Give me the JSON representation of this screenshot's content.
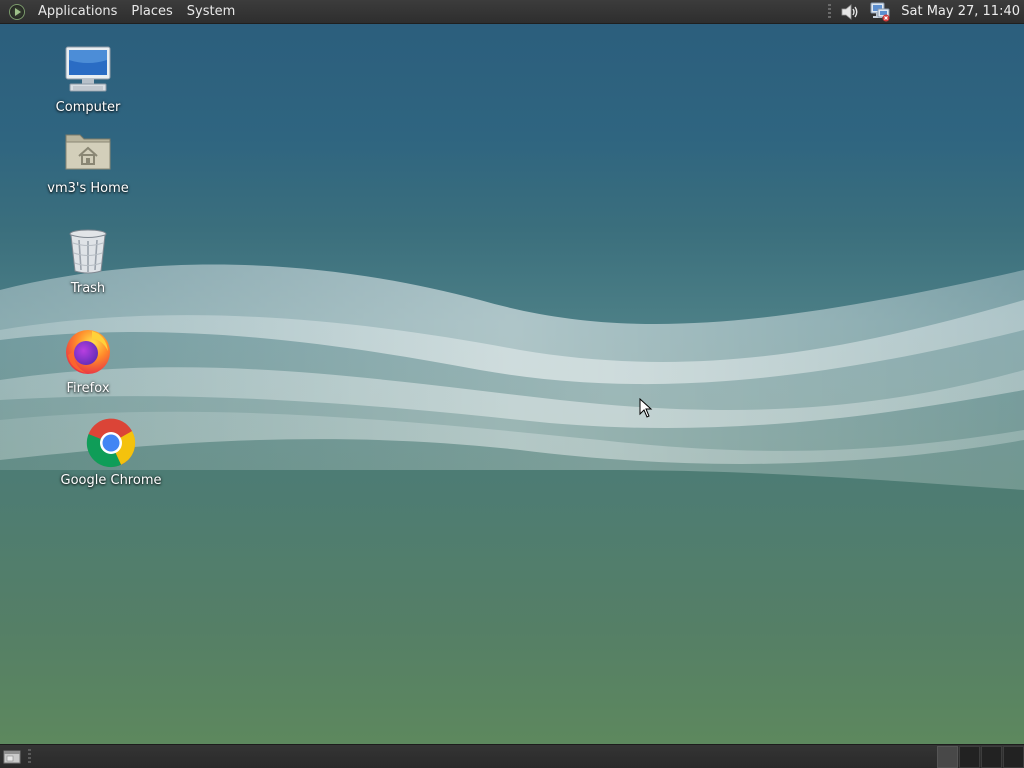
{
  "top_panel": {
    "menus": {
      "applications": "Applications",
      "places": "Places",
      "system": "System"
    },
    "clock": "Sat May 27, 11:40",
    "tray_icons": [
      "volume-icon",
      "network-icon"
    ]
  },
  "desktop": {
    "icons": [
      {
        "label": "Computer",
        "icon": "computer-icon"
      },
      {
        "label": "vm3's Home",
        "icon": "home-folder-icon"
      },
      {
        "label": "Trash",
        "icon": "trash-icon"
      },
      {
        "label": "Firefox",
        "icon": "firefox-icon"
      },
      {
        "label": "Google Chrome",
        "icon": "chrome-icon"
      }
    ]
  },
  "bottom_panel": {
    "workspaces": 4,
    "active_workspace": 1
  },
  "colors": {
    "panel": "#2e2e2e",
    "wallpaper_top": "#2b5d7c",
    "wallpaper_bottom": "#5f8a5c"
  }
}
